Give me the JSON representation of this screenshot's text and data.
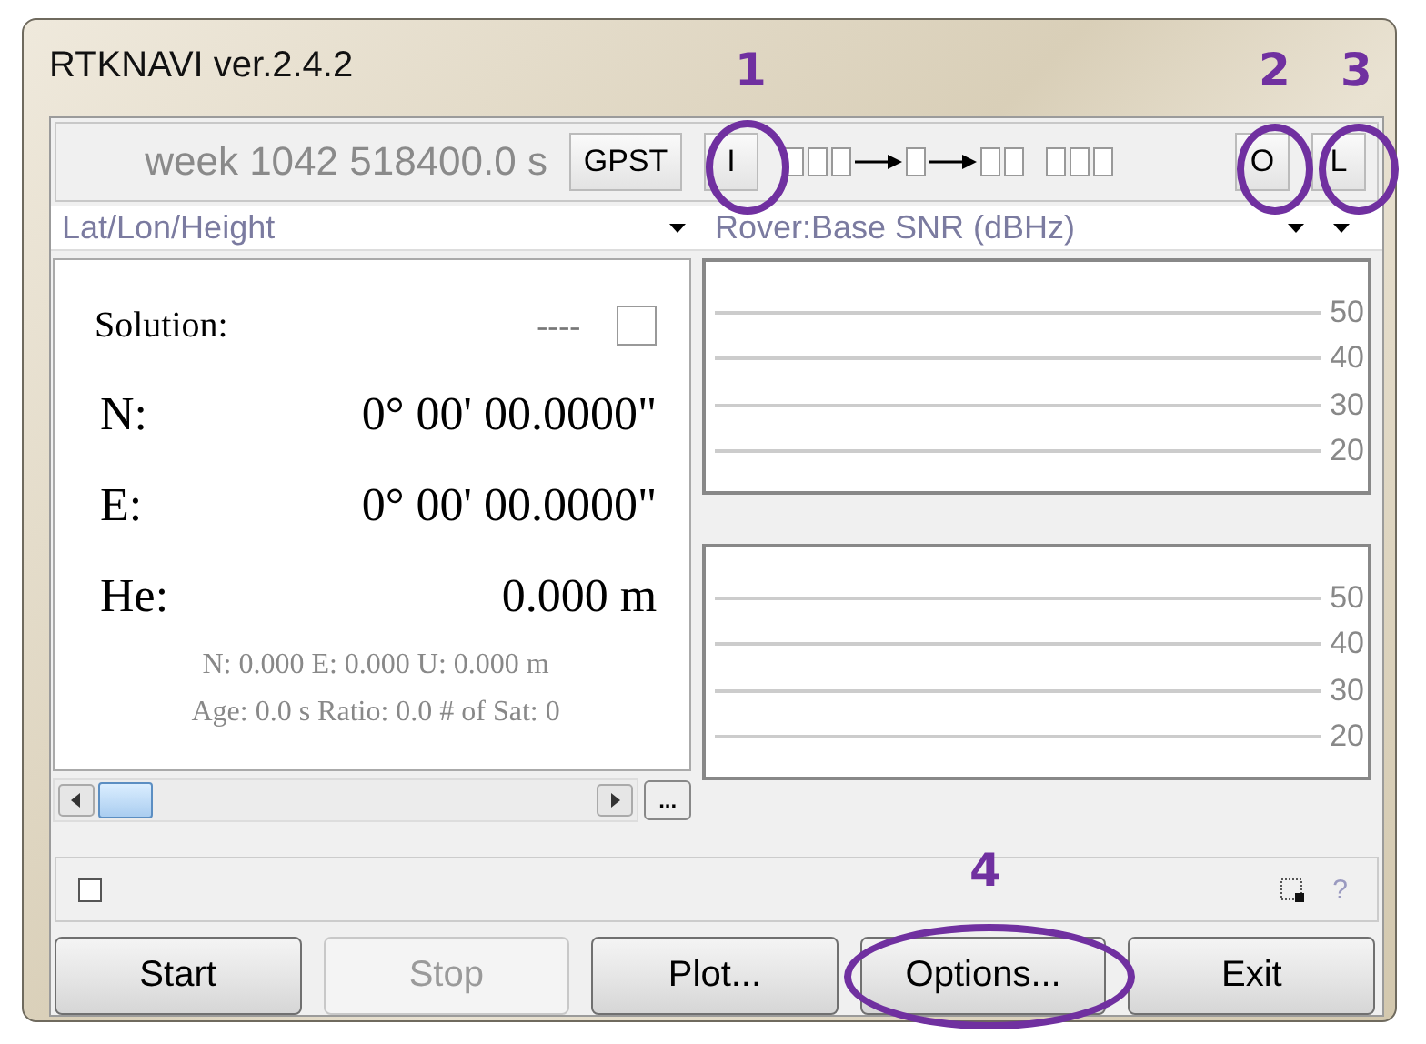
{
  "window": {
    "title": "RTKNAVI ver.2.4.2"
  },
  "toolbar": {
    "time": "week 1042 518400.0 s",
    "time_system_button": "GPST",
    "input_button": "I",
    "streams": [
      {
        "kind": "box"
      },
      {
        "kind": "box"
      },
      {
        "kind": "box"
      },
      {
        "kind": "arrow"
      },
      {
        "kind": "box"
      },
      {
        "kind": "arrow"
      },
      {
        "kind": "box"
      },
      {
        "kind": "box"
      },
      {
        "kind": "gap"
      },
      {
        "kind": "box"
      },
      {
        "kind": "box"
      },
      {
        "kind": "box"
      }
    ],
    "output_button": "O",
    "log_button": "L"
  },
  "solution_format": {
    "label": "Lat/Lon/Height"
  },
  "plot_type": {
    "label": "Rover:Base SNR (dBHz)"
  },
  "solution": {
    "label": "Solution:",
    "status": "----",
    "indicator_on": false,
    "rows": [
      {
        "label": "N:",
        "value": "0° 00' 00.0000\""
      },
      {
        "label": "E:",
        "value": "0° 00' 00.0000\""
      },
      {
        "label": "He:",
        "value": "0.000 m"
      }
    ],
    "details": [
      "N: 0.000 E: 0.000 U: 0.000 m",
      "Age: 0.0 s Ratio: 0.0 # of Sat: 0"
    ]
  },
  "snr_plots": [
    {
      "ticks": [
        "50",
        "40",
        "30",
        "20"
      ]
    },
    {
      "ticks": [
        "50",
        "40",
        "30",
        "20"
      ]
    }
  ],
  "horizontal_scroll": {
    "more_button": "..."
  },
  "status_bar": {
    "checked": false,
    "help": "?"
  },
  "buttons": [
    {
      "label": "Start",
      "disabled": false
    },
    {
      "label": "Stop",
      "disabled": true
    },
    {
      "label": "Plot...",
      "disabled": false
    },
    {
      "label": "Options...",
      "disabled": false
    },
    {
      "label": "Exit",
      "disabled": false
    }
  ],
  "callouts": [
    {
      "number": "1"
    },
    {
      "number": "2"
    },
    {
      "number": "3"
    },
    {
      "number": "4"
    }
  ]
}
